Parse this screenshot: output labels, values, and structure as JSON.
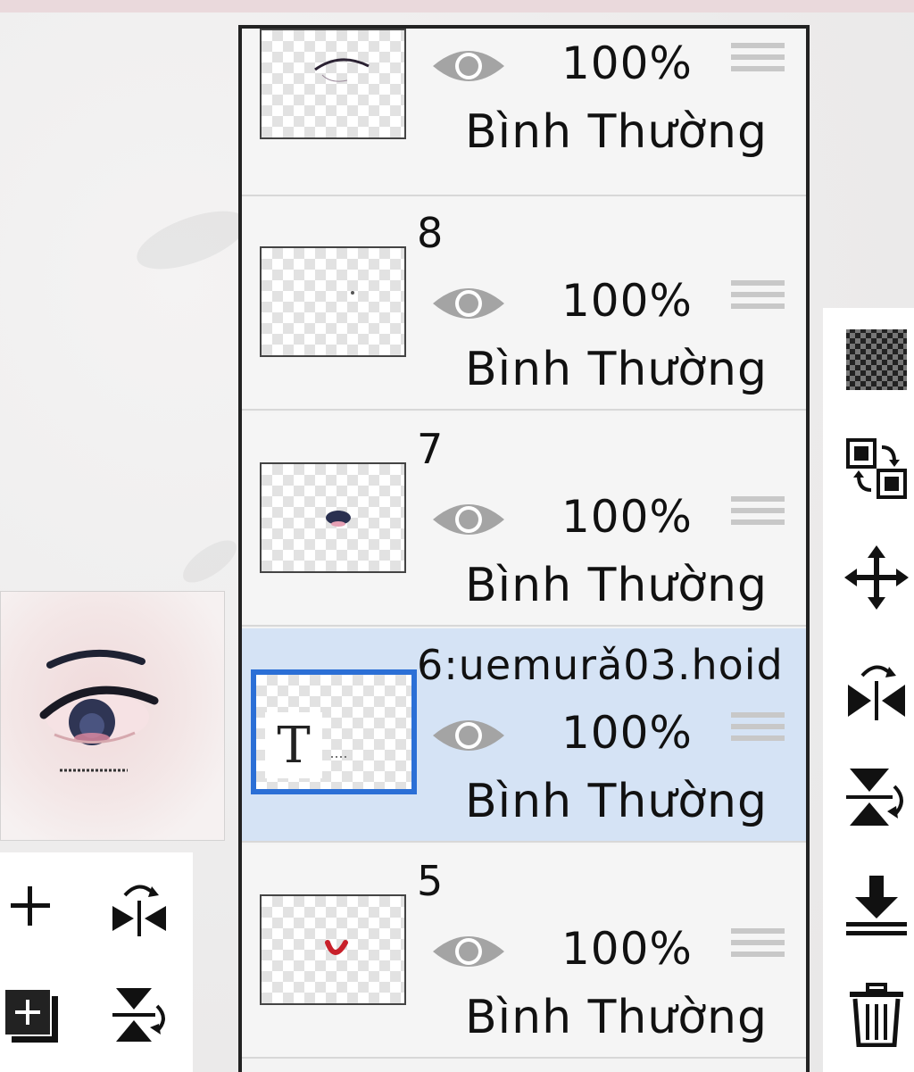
{
  "layers_panel": {
    "layers": [
      {
        "name": "",
        "opacity": "100%",
        "blend_mode": "Bình Thường",
        "visible": true,
        "selected": false,
        "thumbnail": "eyebrow-stroke"
      },
      {
        "name": "8",
        "opacity": "100%",
        "blend_mode": "Bình Thường",
        "visible": true,
        "selected": false,
        "thumbnail": "tiny-dot"
      },
      {
        "name": "7",
        "opacity": "100%",
        "blend_mode": "Bình Thường",
        "visible": true,
        "selected": false,
        "thumbnail": "iris"
      },
      {
        "name": "6:uemurǎ03.hoid",
        "opacity": "100%",
        "blend_mode": "Bình Thường",
        "visible": true,
        "selected": true,
        "thumbnail": "text-layer",
        "text_badge": "T"
      },
      {
        "name": "5",
        "opacity": "100%",
        "blend_mode": "Bình Thường",
        "visible": true,
        "selected": false,
        "thumbnail": "red-mark"
      }
    ]
  },
  "left_tools": [
    {
      "icon": "plus-icon",
      "label": "add-layer"
    },
    {
      "icon": "flip-horizontal-icon",
      "label": "flip-horizontal"
    },
    {
      "icon": "add-layer-square-icon",
      "label": "add-layer-alt"
    },
    {
      "icon": "flip-vertical-icon",
      "label": "flip-vertical"
    }
  ],
  "right_tools": [
    {
      "icon": "transparency-checker-icon"
    },
    {
      "icon": "swap-layers-icon"
    },
    {
      "icon": "move-arrows-icon"
    },
    {
      "icon": "flip-horizontal-icon"
    },
    {
      "icon": "flip-vertical-icon"
    },
    {
      "icon": "merge-down-icon"
    },
    {
      "icon": "trash-icon"
    }
  ],
  "colors": {
    "selected_row": "#d5e3f5",
    "selected_border": "#2b6fd6",
    "panel_border": "#222222"
  }
}
